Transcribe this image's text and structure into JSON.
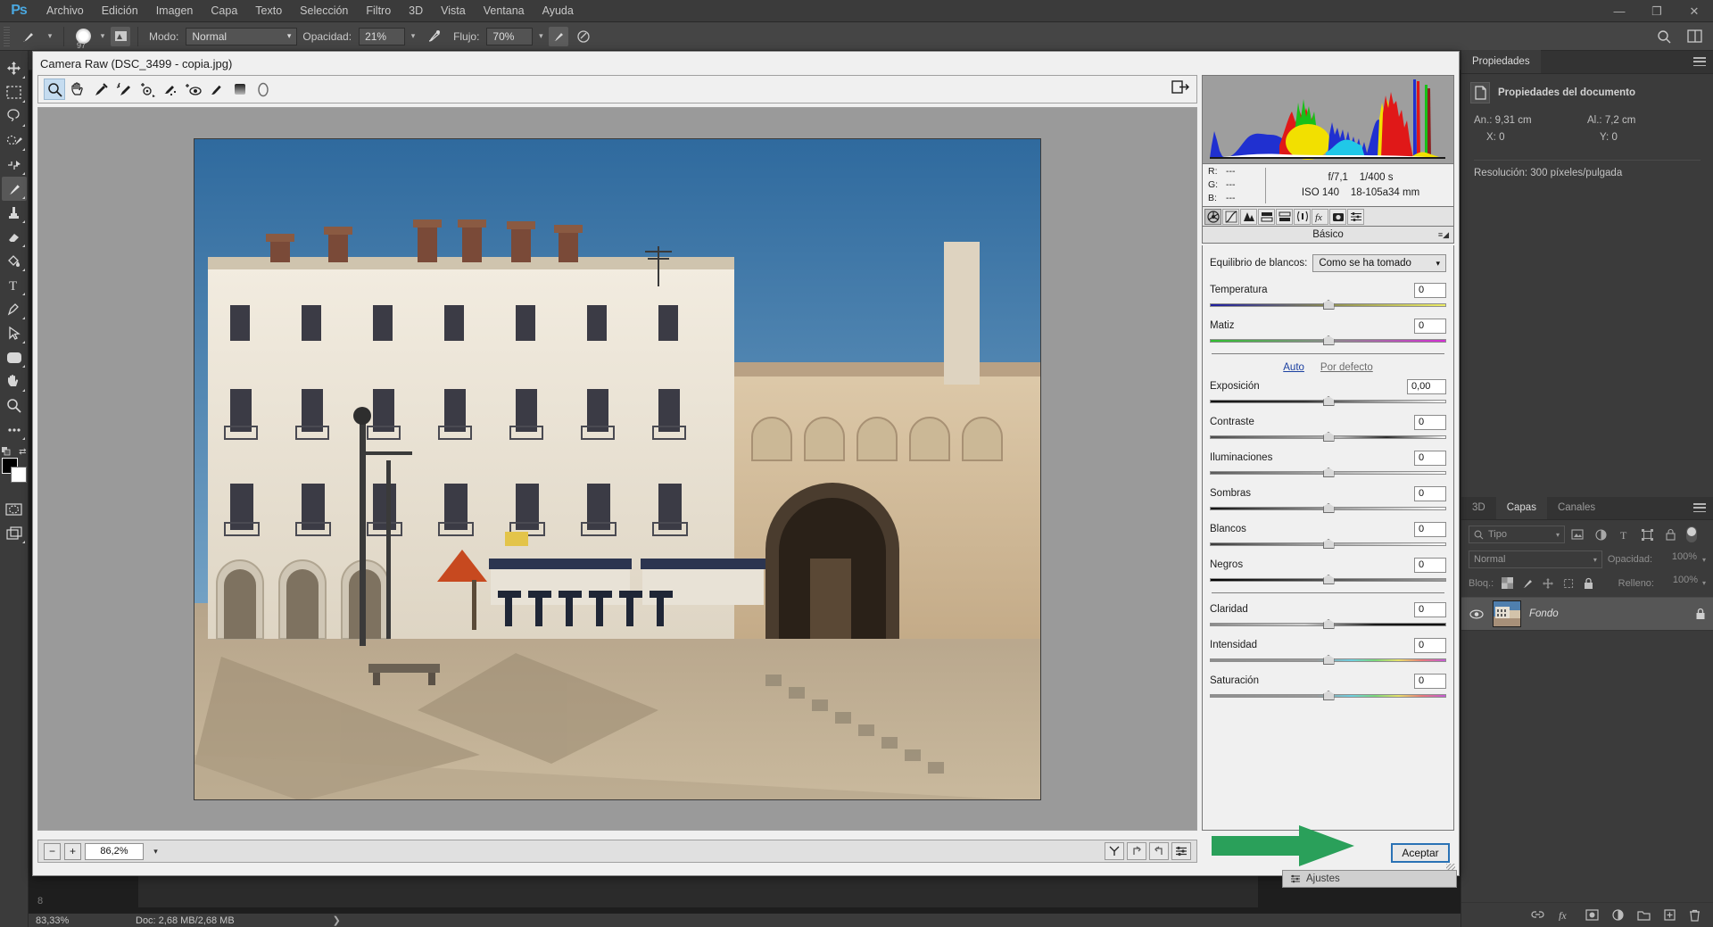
{
  "app": {
    "logo": "Ps",
    "menus": [
      "Archivo",
      "Edición",
      "Imagen",
      "Capa",
      "Texto",
      "Selección",
      "Filtro",
      "3D",
      "Vista",
      "Ventana",
      "Ayuda"
    ],
    "window_buttons": {
      "minimize": "—",
      "restore": "❐",
      "close": "✕"
    }
  },
  "options_bar": {
    "brush_size": "97",
    "mode_label": "Modo:",
    "mode_value": "Normal",
    "opacity_label": "Opacidad:",
    "opacity_value": "21%",
    "flow_label": "Flujo:",
    "flow_value": "70%",
    "airbrush_icon": "airbrush-icon",
    "smoothing_icon": "smoothing-icon",
    "search_icon": "search-icon",
    "arrange_icon": "arrange-documents-icon"
  },
  "toolbar": {
    "tools": [
      {
        "name": "move-tool",
        "glyph": "move"
      },
      {
        "name": "marquee-tool",
        "glyph": "marquee"
      },
      {
        "name": "lasso-tool",
        "glyph": "lasso"
      },
      {
        "name": "quick-selection-tool",
        "glyph": "quickselect"
      },
      {
        "name": "crop-tool",
        "glyph": "crop"
      },
      {
        "name": "brush-tool",
        "glyph": "brush",
        "active": true
      },
      {
        "name": "clone-stamp-tool",
        "glyph": "stamp"
      },
      {
        "name": "eraser-tool",
        "glyph": "eraser"
      },
      {
        "name": "gradient-tool",
        "glyph": "bucket"
      },
      {
        "name": "type-tool",
        "glyph": "text"
      },
      {
        "name": "pen-tool",
        "glyph": "pen"
      },
      {
        "name": "path-selection-tool",
        "glyph": "arrow"
      },
      {
        "name": "shape-tool",
        "glyph": "rect"
      },
      {
        "name": "hand-tool",
        "glyph": "hand"
      },
      {
        "name": "zoom-tool",
        "glyph": "zoom"
      },
      {
        "name": "more-tools",
        "glyph": "dots"
      }
    ],
    "foreground_color": "#000000",
    "background_color": "#ffffff"
  },
  "camera_raw": {
    "title": "Camera Raw (DSC_3499 - copia.jpg)",
    "tools": [
      {
        "name": "zoom-tool",
        "active": true
      },
      {
        "name": "hand-tool"
      },
      {
        "name": "white-balance-tool"
      },
      {
        "name": "color-sampler-tool"
      },
      {
        "name": "targeted-adjustment-tool"
      },
      {
        "name": "spot-removal-tool"
      },
      {
        "name": "red-eye-tool"
      },
      {
        "name": "adjustment-brush-tool"
      },
      {
        "name": "graduated-filter-tool"
      },
      {
        "name": "radial-filter-tool"
      }
    ],
    "toggle_fullscreen_icon": "toggle-fullscreen-icon",
    "zoom": {
      "minus": "−",
      "plus": "+",
      "value": "86,2%"
    },
    "preview_buttons": [
      "preview-toggle",
      "rotate-ccw",
      "rotate-cw",
      "settings"
    ],
    "histogram": {
      "shadow_clip_icon": "shadow-clipping-icon",
      "highlight_clip_icon": "highlight-clipping-icon"
    },
    "readout": {
      "r_label": "R:",
      "r_value": "---",
      "g_label": "G:",
      "g_value": "---",
      "b_label": "B:",
      "b_value": "---",
      "aperture": "f/7,1",
      "shutter": "1/400 s",
      "iso": "ISO 140",
      "lens": "18-105a34 mm"
    },
    "panel_tabs": [
      {
        "name": "basic-tab",
        "active": true
      },
      {
        "name": "tone-curve-tab"
      },
      {
        "name": "detail-tab"
      },
      {
        "name": "hsl-grayscale-tab"
      },
      {
        "name": "split-toning-tab"
      },
      {
        "name": "lens-corrections-tab"
      },
      {
        "name": "effects-tab"
      },
      {
        "name": "camera-calibration-tab"
      },
      {
        "name": "presets-tab"
      }
    ],
    "panel_title": "Básico",
    "white_balance": {
      "label": "Equilibrio de blancos:",
      "value": "Como se ha tomado"
    },
    "auto": "Auto",
    "default": "Por defecto",
    "sliders": [
      {
        "label": "Temperatura",
        "value": "0",
        "pos": 50,
        "track": "temp"
      },
      {
        "label": "Matiz",
        "value": "0",
        "pos": 50,
        "track": "tint"
      },
      {
        "label": "Exposición",
        "value": "0,00",
        "pos": 50,
        "track": "expo"
      },
      {
        "label": "Contraste",
        "value": "0",
        "pos": 50,
        "track": "contrast"
      },
      {
        "label": "Iluminaciones",
        "value": "0",
        "pos": 50,
        "track": "plain"
      },
      {
        "label": "Sombras",
        "value": "0",
        "pos": 50,
        "track": "shadow"
      },
      {
        "label": "Blancos",
        "value": "0",
        "pos": 50,
        "track": "white"
      },
      {
        "label": "Negros",
        "value": "0",
        "pos": 50,
        "track": "black"
      },
      {
        "label": "Claridad",
        "value": "0",
        "pos": 50,
        "track": "clarity"
      },
      {
        "label": "Intensidad",
        "value": "0",
        "pos": 50,
        "track": "vibrance"
      },
      {
        "label": "Saturación",
        "value": "0",
        "pos": 50,
        "track": "saturation"
      }
    ],
    "ok_button": "Aceptar"
  },
  "annotation": {
    "arrow_color": "#2aa05a",
    "points_to": "Aceptar"
  },
  "properties_panel": {
    "tab": "Propiedades",
    "heading": "Propiedades del documento",
    "width_label": "An.:",
    "width_value": "9,31 cm",
    "height_label": "Al.:",
    "height_value": "7,2 cm",
    "x_label": "X:",
    "x_value": "0",
    "y_label": "Y:",
    "y_value": "0",
    "resolution": "Resolución: 300 píxeles/pulgada"
  },
  "layers_panel": {
    "tabs": [
      "3D",
      "Capas",
      "Canales"
    ],
    "active_tab": "Capas",
    "filter_placeholder": "Tipo",
    "filter_icons": [
      "pixel-filter-icon",
      "adjustment-filter-icon",
      "type-filter-icon",
      "shape-filter-icon",
      "smart-object-filter-icon"
    ],
    "blend_mode": "Normal",
    "opacity_label": "Opacidad:",
    "opacity_value": "100%",
    "lock_label": "Bloq.:",
    "lock_icons": [
      "lock-transparency-icon",
      "lock-image-icon",
      "lock-position-icon",
      "lock-artboard-icon",
      "lock-all-icon"
    ],
    "fill_label": "Relleno:",
    "fill_value": "100%",
    "layers": [
      {
        "name": "Fondo",
        "visible": true,
        "locked": true
      }
    ],
    "bottom_icons": [
      "link-layers-icon",
      "fx-icon",
      "mask-icon",
      "adjustment-icon",
      "group-icon",
      "new-layer-icon",
      "delete-layer-icon"
    ]
  },
  "status_bar": {
    "zoom": "83,33%",
    "doc_info": "Doc: 2,68 MB/2,68 MB",
    "expand_arrow": "❯",
    "ruler_mark": "8"
  },
  "adjustments_tab": {
    "label": "Ajustes",
    "icon": "adjustments-icon"
  },
  "colors": {
    "chrome_dark": "#3b3b3b",
    "chrome_mid": "#454545",
    "canvas_bg": "#1e1e1e",
    "dialog_bg": "#f0f0f0",
    "accent_blue": "#2a72b5",
    "annotation_green": "#2aa05a"
  }
}
